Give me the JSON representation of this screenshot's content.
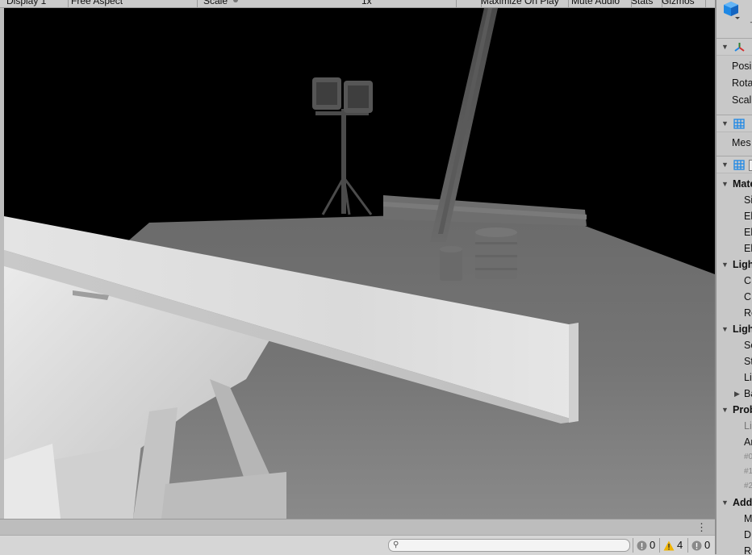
{
  "toolbar": {
    "display": "Display 1",
    "aspect": "Free Aspect",
    "scale_label": "Scale",
    "scale_value": "1x",
    "maximize": "Maximize On Play",
    "mute": "Mute Audio",
    "stats": "Stats",
    "gizmos": "Gizmos"
  },
  "console": {
    "search_placeholder": "",
    "errors_count": "0",
    "warnings_count": "4",
    "messages_count": "0",
    "menu_glyph": "⋮"
  },
  "inspector": {
    "header_icon": "cube-icon",
    "transform": {
      "position": "Posi",
      "rotation": "Rota",
      "scale": "Scal"
    },
    "mesh_filter": {
      "mesh": "Mes"
    },
    "mesh_renderer": {
      "materials": "Mate",
      "size": "Si",
      "element0": "El",
      "element1": "El",
      "element2": "El",
      "lighting": "Ligh",
      "cast": "C",
      "contribute": "C",
      "receive": "Re",
      "lightmapping": "Ligh",
      "scale_lm": "Sc",
      "stitch": "St",
      "lightmap_params": "Li",
      "baked": "Ba",
      "probes": "Prob",
      "light_probes": "Li",
      "anchor": "An",
      "probe0": "#0",
      "probe1": "#1",
      "probe2": "#2",
      "additional": "Add",
      "motion": "M",
      "dynamic": "D",
      "rendering": "Re"
    }
  },
  "colors": {
    "viewport_bg": "#000000",
    "accent_blue": "#1e88e5",
    "warning_yellow": "#f0b400"
  }
}
